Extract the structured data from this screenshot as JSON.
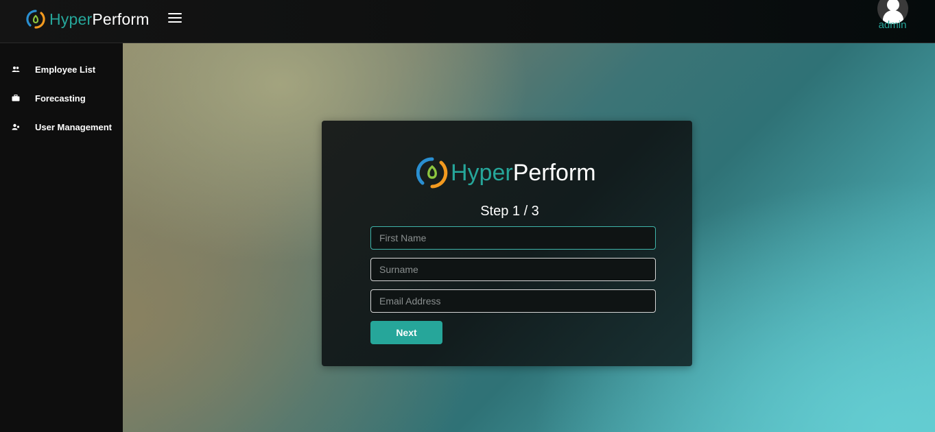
{
  "brand": {
    "part1": "Hyper",
    "part2": "Perform"
  },
  "header": {
    "username": "admin",
    "menu_icon": "hamburger-icon",
    "avatar_icon": "user-avatar-icon"
  },
  "sidebar": {
    "items": [
      {
        "label": "Employee List",
        "icon": "users-icon"
      },
      {
        "label": "Forecasting",
        "icon": "briefcase-icon"
      },
      {
        "label": "User Management",
        "icon": "user-settings-icon"
      }
    ]
  },
  "form": {
    "step_label": "Step 1 / 3",
    "first_name": {
      "placeholder": "First Name",
      "value": ""
    },
    "surname": {
      "placeholder": "Surname",
      "value": ""
    },
    "email": {
      "placeholder": "Email Address",
      "value": ""
    },
    "next_label": "Next"
  },
  "colors": {
    "accent": "#26a69a",
    "logo_blue": "#2a8fd1",
    "logo_orange": "#f39a1f",
    "logo_green": "#8dc63f"
  }
}
